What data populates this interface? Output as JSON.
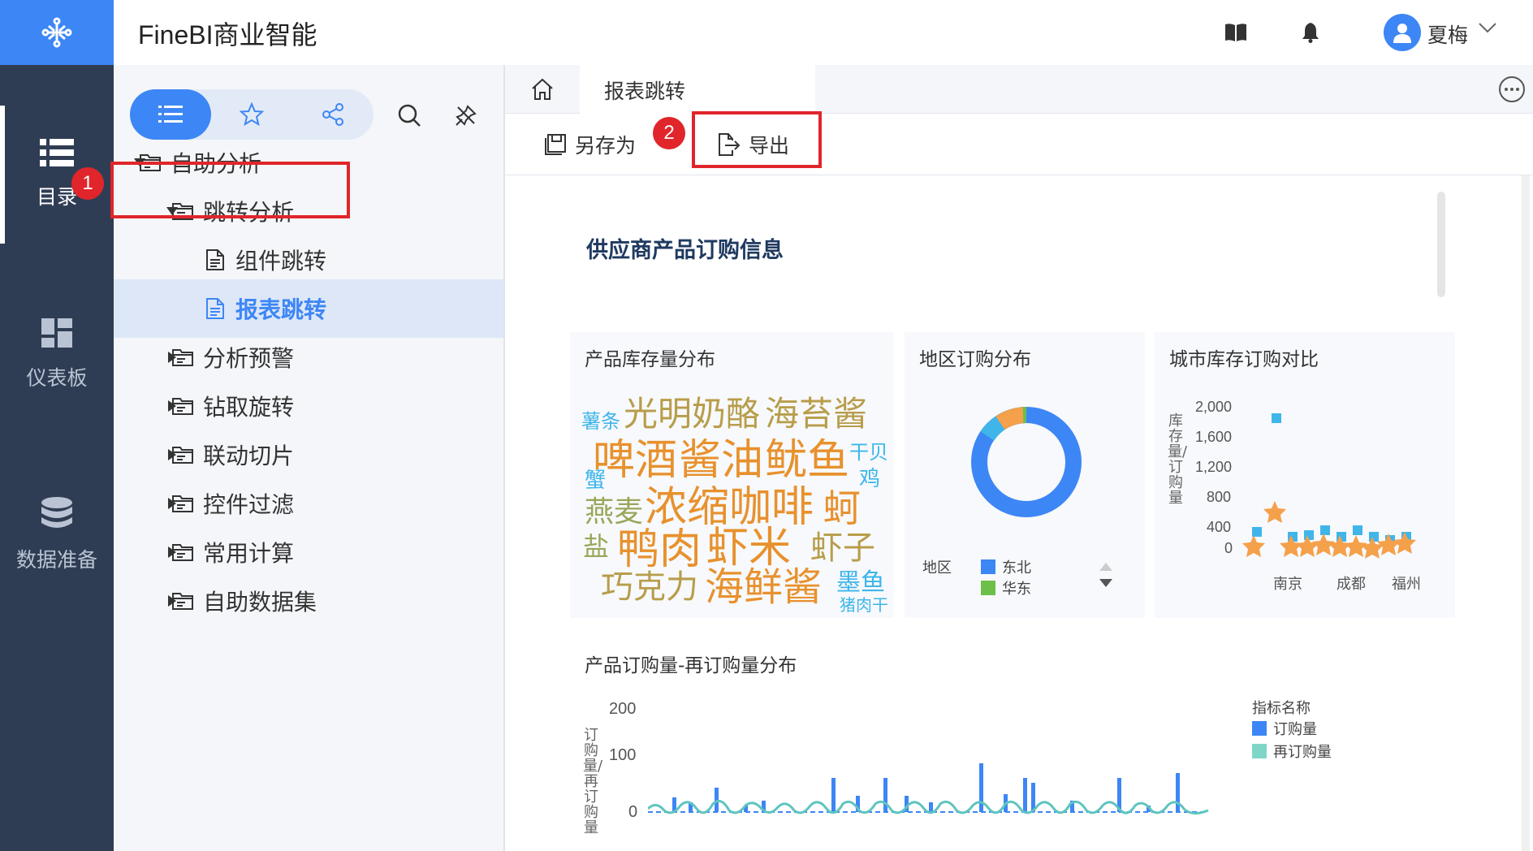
{
  "app": {
    "title": "FineBI商业智能"
  },
  "user": {
    "name": "夏梅"
  },
  "rail": {
    "items": [
      {
        "label": "目录",
        "active": true
      },
      {
        "label": "仪表板",
        "active": false
      },
      {
        "label": "数据准备",
        "active": false
      }
    ]
  },
  "catalog": {
    "tree": [
      {
        "label": "自助分析",
        "level": 0,
        "expanded": true,
        "type": "folder"
      },
      {
        "label": "跳转分析",
        "level": 1,
        "expanded": true,
        "type": "folder"
      },
      {
        "label": "组件跳转",
        "level": 2,
        "type": "report"
      },
      {
        "label": "报表跳转",
        "level": 2,
        "type": "report",
        "selected": true
      },
      {
        "label": "分析预警",
        "level": 1,
        "expanded": false,
        "type": "folder"
      },
      {
        "label": "钻取旋转",
        "level": 1,
        "expanded": false,
        "type": "folder"
      },
      {
        "label": "联动切片",
        "level": 1,
        "expanded": false,
        "type": "folder"
      },
      {
        "label": "控件过滤",
        "level": 1,
        "expanded": false,
        "type": "folder"
      },
      {
        "label": "常用计算",
        "level": 1,
        "expanded": false,
        "type": "folder"
      },
      {
        "label": "自助数据集",
        "level": 1,
        "expanded": false,
        "type": "folder"
      }
    ]
  },
  "annotations": {
    "step1": "1",
    "step2": "2"
  },
  "tabs": {
    "active": "报表跳转"
  },
  "toolbar": {
    "save_as": "另存为",
    "export": "导出"
  },
  "dashboard": {
    "title": "供应商产品订购信息",
    "widgets": {
      "wordcloud": {
        "title": "产品库存量分布",
        "words": [
          "薯条",
          "光明奶酪",
          "海苔酱",
          "啤酒",
          "酱油",
          "鱿鱼",
          "干贝",
          "鸡",
          "蟹",
          "燕麦",
          "浓缩咖啡",
          "蚵",
          "盐",
          "鸭肉",
          "虾米",
          "虾子",
          "巧克力",
          "海鲜酱",
          "墨鱼",
          "猪肉干"
        ]
      },
      "donut": {
        "title": "地区订购分布",
        "legend_title": "地区",
        "legend": [
          "东北",
          "华东"
        ]
      },
      "scatter": {
        "title": "城市库存订购对比",
        "y_label": "库存量/订购量",
        "y_ticks": [
          "2,000",
          "1,600",
          "1,200",
          "800",
          "400",
          "0"
        ],
        "x_ticks": [
          "南京",
          "成都",
          "福州"
        ]
      },
      "combo": {
        "title": "产品订购量-再订购量分布",
        "y_label": "订购量/再订购量",
        "y_ticks": [
          "200",
          "100",
          "0"
        ],
        "legend_title": "指标名称",
        "legend": [
          "订购量",
          "再订购量"
        ]
      }
    }
  },
  "colors": {
    "brand": "#3d86f5",
    "rail": "#2f3d54",
    "highlight": "#e0262b",
    "bar": "#3d86f5",
    "line": "#5ec4c0",
    "orange": "#f5a04a",
    "cyan": "#3fb5ea"
  }
}
